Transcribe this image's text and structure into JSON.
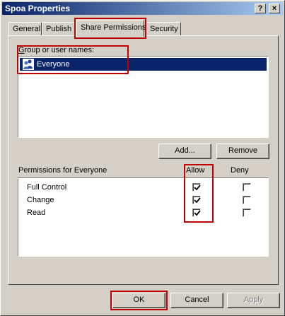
{
  "window": {
    "title": "Spoa Properties",
    "help_label": "?",
    "close_label": "×"
  },
  "tabs": [
    {
      "label": "General"
    },
    {
      "label": "Publish"
    },
    {
      "label": "Share Permissions"
    },
    {
      "label": "Security"
    }
  ],
  "active_tab": "Share Permissions",
  "group_section": {
    "label_prefix": "G",
    "label_rest": "roup or user names:",
    "users": [
      {
        "name": "Everyone",
        "selected": true,
        "icon": "users-group-icon"
      }
    ]
  },
  "buttons": {
    "add": "Add...",
    "remove": "Remove",
    "ok": "OK",
    "cancel": "Cancel",
    "apply": "Apply"
  },
  "permissions": {
    "header": "Permissions for Everyone",
    "allow_header": "Allow",
    "deny_header": "Deny",
    "rows": [
      {
        "name": "Full Control",
        "allow": true,
        "deny": false
      },
      {
        "name": "Change",
        "allow": true,
        "deny": false
      },
      {
        "name": "Read",
        "allow": true,
        "deny": false
      }
    ]
  },
  "colors": {
    "titlebar_start": "#0a246a",
    "titlebar_end": "#a6caf0",
    "selection": "#0a246a",
    "annotation": "#c00000",
    "face": "#d4d0c8"
  }
}
